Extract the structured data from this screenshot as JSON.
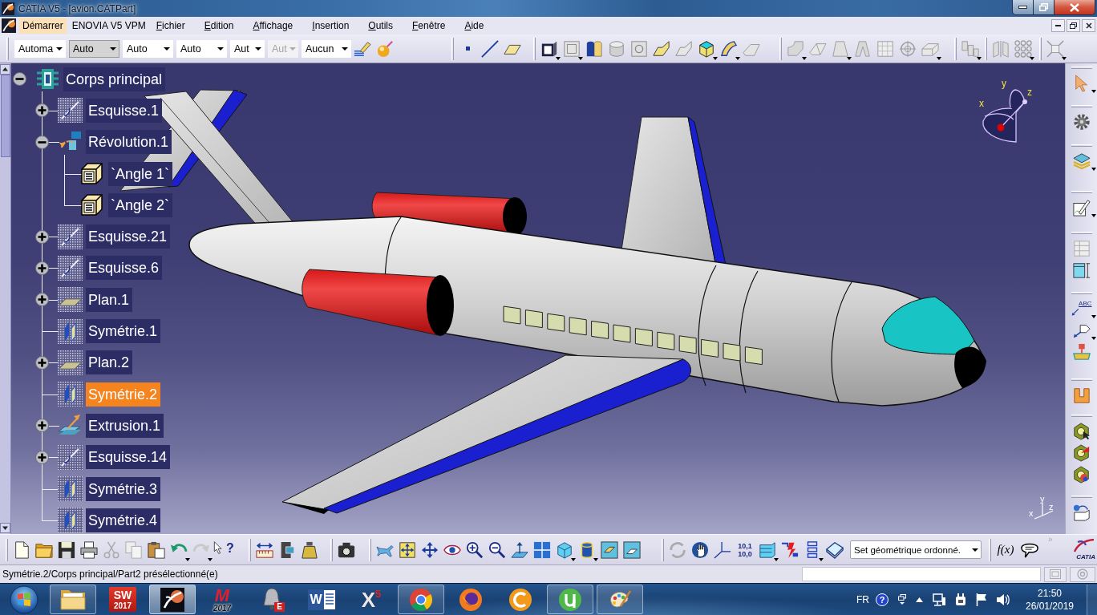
{
  "window": {
    "title": "CATIA V5 - [avion.CATPart]"
  },
  "menu": [
    {
      "label": "Démarrer",
      "selected": true,
      "access_key": false
    },
    {
      "label": "ENOVIA V5 VPM",
      "selected": false,
      "access_key": false
    },
    {
      "label": "Fichier",
      "selected": false,
      "access_key": true
    },
    {
      "label": "Edition",
      "selected": false,
      "access_key": true
    },
    {
      "label": "Affichage",
      "selected": false,
      "access_key": true
    },
    {
      "label": "Insertion",
      "selected": false,
      "access_key": true
    },
    {
      "label": "Outils",
      "selected": false,
      "access_key": true
    },
    {
      "label": "Fenêtre",
      "selected": false,
      "access_key": true
    },
    {
      "label": "Aide",
      "selected": false,
      "access_key": true
    }
  ],
  "style_toolbar": {
    "dropdowns": [
      {
        "value": "Automa",
        "focused": false,
        "disabled": false
      },
      {
        "value": "Auto",
        "focused": true,
        "disabled": false
      },
      {
        "value": "Auto",
        "focused": false,
        "disabled": false
      },
      {
        "value": "Auto",
        "focused": false,
        "disabled": false
      },
      {
        "value": "Aut",
        "focused": false,
        "disabled": false
      },
      {
        "value": "Aut",
        "focused": false,
        "disabled": true
      },
      {
        "value": "Aucun",
        "focused": false,
        "disabled": false
      }
    ]
  },
  "tree": {
    "label": "Corps principal",
    "kind": "body",
    "expanded": true,
    "selected": false,
    "children": [
      {
        "label": "Esquisse.1",
        "kind": "sketch",
        "expanded": false,
        "selected": false
      },
      {
        "label": "Révolution.1",
        "kind": "revolution",
        "expanded": true,
        "selected": false,
        "children": [
          {
            "label": "`Angle 1`",
            "kind": "parameter",
            "selected": false
          },
          {
            "label": "`Angle 2`",
            "kind": "parameter",
            "selected": false
          }
        ]
      },
      {
        "label": "Esquisse.21",
        "kind": "sketch",
        "expanded": false,
        "selected": false
      },
      {
        "label": "Esquisse.6",
        "kind": "sketch",
        "expanded": false,
        "selected": false
      },
      {
        "label": "Plan.1",
        "kind": "plane",
        "expanded": false,
        "selected": false
      },
      {
        "label": "Symétrie.1",
        "kind": "symmetry",
        "selected": false
      },
      {
        "label": "Plan.2",
        "kind": "plane",
        "expanded": false,
        "selected": false
      },
      {
        "label": "Symétrie.2",
        "kind": "symmetry",
        "selected": true
      },
      {
        "label": "Extrusion.1",
        "kind": "extrusion",
        "expanded": false,
        "selected": false
      },
      {
        "label": "Esquisse.14",
        "kind": "sketch",
        "expanded": false,
        "selected": false
      },
      {
        "label": "Symétrie.3",
        "kind": "symmetry",
        "selected": false
      },
      {
        "label": "Symétrie.4",
        "kind": "symmetry",
        "selected": false
      }
    ]
  },
  "compass": {
    "axis_labels": [
      "x",
      "y",
      "z"
    ]
  },
  "axis_triad": {
    "axis_labels": [
      "x",
      "y",
      "z"
    ]
  },
  "right_toolbar": {
    "annotation_label": "ABC"
  },
  "bottom_toolbar": {
    "help_glyph": "?",
    "units_label": [
      "10,1",
      "10,0"
    ],
    "body_dropdown": {
      "value": "Set géométrique ordonné."
    },
    "formula_label": "f(x)",
    "overflow_glyph": "»",
    "logo_text": "CATIA"
  },
  "status_bar": {
    "message": "Symétrie.2/Corps principal/Part2 présélectionné(e)"
  },
  "taskbar": {
    "apps": [
      {
        "running": true,
        "selected": false
      },
      {
        "running": false,
        "selected": false,
        "logo_text": [
          "SW",
          "2017"
        ]
      },
      {
        "running": true,
        "selected": true
      },
      {
        "running": false,
        "selected": false,
        "logo_text": [
          "M",
          "2017"
        ]
      },
      {
        "running": false,
        "selected": false,
        "logo_text": [
          "E"
        ]
      },
      {
        "running": false,
        "selected": false,
        "logo_text": [
          "W"
        ]
      },
      {
        "running": false,
        "selected": false,
        "logo_text": [
          "X",
          "5"
        ]
      },
      {
        "running": true,
        "selected": false
      },
      {
        "running": false,
        "selected": false
      },
      {
        "running": false,
        "selected": false
      },
      {
        "running": true,
        "selected": false
      },
      {
        "running": true,
        "selected": false
      }
    ]
  },
  "tray": {
    "language": "FR",
    "help_glyph": "?",
    "time": "21:50",
    "date": "26/01/2019"
  }
}
